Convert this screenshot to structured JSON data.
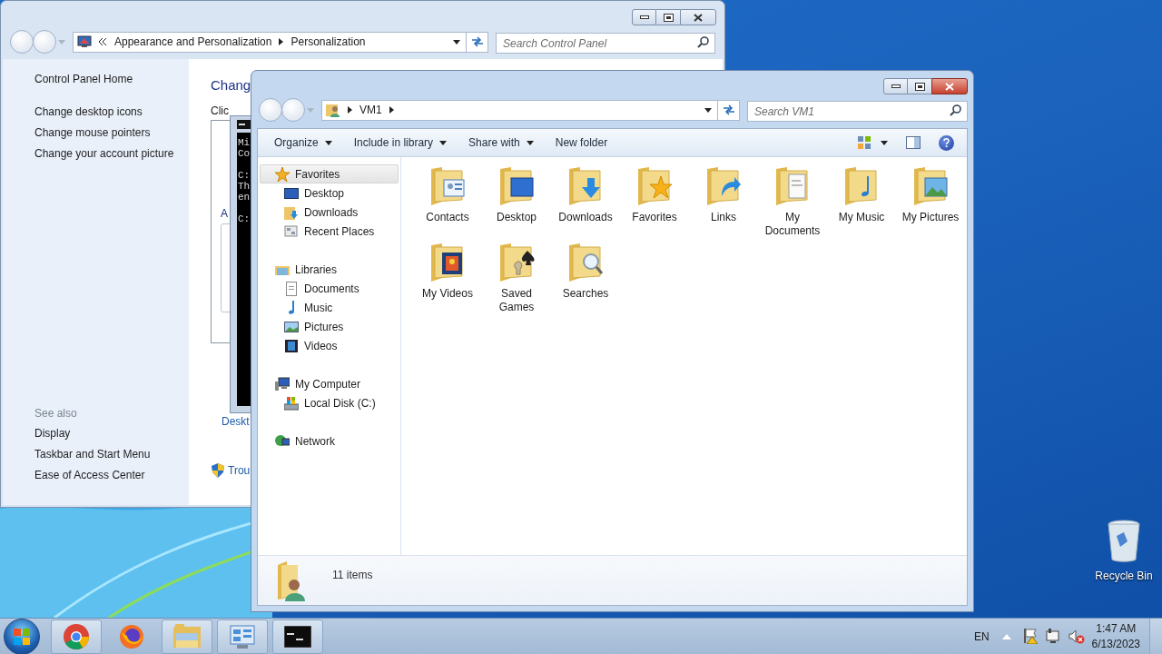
{
  "control_panel": {
    "active": false,
    "breadcrumb": [
      "Appearance and Personalization",
      "Personalization"
    ],
    "search_placeholder": "Search Control Panel",
    "sidebar_links": [
      "Control Panel Home",
      "Change desktop icons",
      "Change mouse pointers",
      "Change your account picture"
    ],
    "see_also": {
      "heading": "See also",
      "links": [
        "Display",
        "Taskbar and Start Menu",
        "Ease of Access Center"
      ]
    },
    "content": {
      "title": "Chang",
      "subtitle": "Clic",
      "section": "A",
      "link": "Deskt",
      "troubleshoot": "Trou"
    }
  },
  "console": {
    "line_groups": [
      [
        "Mi",
        "Co"
      ],
      [
        "C:",
        "Th",
        "en"
      ],
      [
        "C:"
      ]
    ]
  },
  "explorer": {
    "active": true,
    "path": [
      "VM1"
    ],
    "search_placeholder": "Search VM1",
    "toolbar": [
      {
        "label": "Organize",
        "dropdown": true
      },
      {
        "label": "Include in library",
        "dropdown": true
      },
      {
        "label": "Share with",
        "dropdown": true
      },
      {
        "label": "New folder",
        "dropdown": false
      }
    ],
    "nav": [
      {
        "label": "Favorites",
        "kind": "star",
        "selected": true,
        "children": [
          {
            "label": "Desktop",
            "kind": "desktop",
            "selected": false
          },
          {
            "label": "Downloads",
            "kind": "downloads",
            "selected": false
          },
          {
            "label": "Recent Places",
            "kind": "recent",
            "selected": false
          }
        ]
      },
      {
        "label": "Libraries",
        "kind": "library",
        "selected": false,
        "children": [
          {
            "label": "Documents",
            "kind": "document",
            "selected": false
          },
          {
            "label": "Music",
            "kind": "music",
            "selected": false
          },
          {
            "label": "Pictures",
            "kind": "pictures",
            "selected": false
          },
          {
            "label": "Videos",
            "kind": "videos",
            "selected": false
          }
        ]
      },
      {
        "label": "My Computer",
        "kind": "computer",
        "selected": false,
        "children": [
          {
            "label": "Local Disk (C:)",
            "kind": "disk",
            "selected": false
          }
        ]
      },
      {
        "label": "Network",
        "kind": "network",
        "selected": false
      }
    ],
    "items": [
      {
        "name": "Contacts",
        "kind": "contacts"
      },
      {
        "name": "Desktop",
        "kind": "desktop"
      },
      {
        "name": "Downloads",
        "kind": "downloads"
      },
      {
        "name": "Favorites",
        "kind": "favorites"
      },
      {
        "name": "Links",
        "kind": "links"
      },
      {
        "name": "My Documents",
        "kind": "documents"
      },
      {
        "name": "My Music",
        "kind": "music"
      },
      {
        "name": "My Pictures",
        "kind": "pictures"
      },
      {
        "name": "My Videos",
        "kind": "videos"
      },
      {
        "name": "Saved Games",
        "kind": "games"
      },
      {
        "name": "Searches",
        "kind": "searches"
      }
    ],
    "status": "11 items"
  },
  "desktop_icons": [
    {
      "label": "Recycle Bin"
    }
  ],
  "taskbar": {
    "apps": [
      {
        "kind": "chrome",
        "running": true
      },
      {
        "kind": "firefox",
        "running": false
      },
      {
        "kind": "explorer",
        "running": true
      },
      {
        "kind": "control_panel",
        "running": true
      },
      {
        "kind": "console",
        "running": true
      }
    ],
    "language": "EN",
    "time": "1:47 AM",
    "date": "6/13/2023"
  }
}
